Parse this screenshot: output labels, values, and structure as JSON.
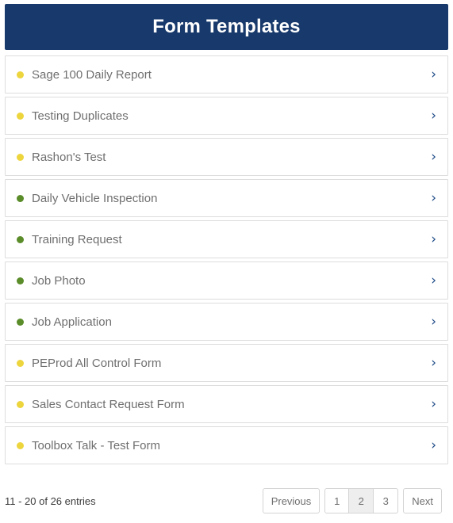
{
  "header": {
    "title": "Form Templates",
    "background_color": "#17396B",
    "text_color": "#FFFFFF"
  },
  "colors": {
    "bullet_yellow": "#EDD53E",
    "bullet_green": "#5B8C2A",
    "chevron": "#1D4A86",
    "row_border": "#DDDDDD",
    "label_text": "#6F6F6F"
  },
  "list": {
    "items": [
      {
        "label": "Sage 100 Daily Report",
        "status_color": "#EDD53E",
        "chevron": "›"
      },
      {
        "label": "Testing Duplicates",
        "status_color": "#EDD53E",
        "chevron": "›"
      },
      {
        "label": "Rashon's Test",
        "status_color": "#EDD53E",
        "chevron": "›"
      },
      {
        "label": "Daily Vehicle Inspection",
        "status_color": "#5B8C2A",
        "chevron": "›"
      },
      {
        "label": "Training Request",
        "status_color": "#5B8C2A",
        "chevron": "›"
      },
      {
        "label": "Job Photo",
        "status_color": "#5B8C2A",
        "chevron": "›"
      },
      {
        "label": "Job Application",
        "status_color": "#5B8C2A",
        "chevron": "›"
      },
      {
        "label": "PEProd All Control Form",
        "status_color": "#EDD53E",
        "chevron": "›"
      },
      {
        "label": "Sales Contact Request Form",
        "status_color": "#EDD53E",
        "chevron": "›"
      },
      {
        "label": "Toolbox Talk - Test Form",
        "status_color": "#EDD53E",
        "chevron": "›"
      }
    ]
  },
  "footer": {
    "entries_info": "11 - 20 of 26 entries",
    "pagination": {
      "previous_label": "Previous",
      "next_label": "Next",
      "pages": [
        {
          "label": "1",
          "active": false
        },
        {
          "label": "2",
          "active": true
        },
        {
          "label": "3",
          "active": false
        }
      ]
    }
  }
}
